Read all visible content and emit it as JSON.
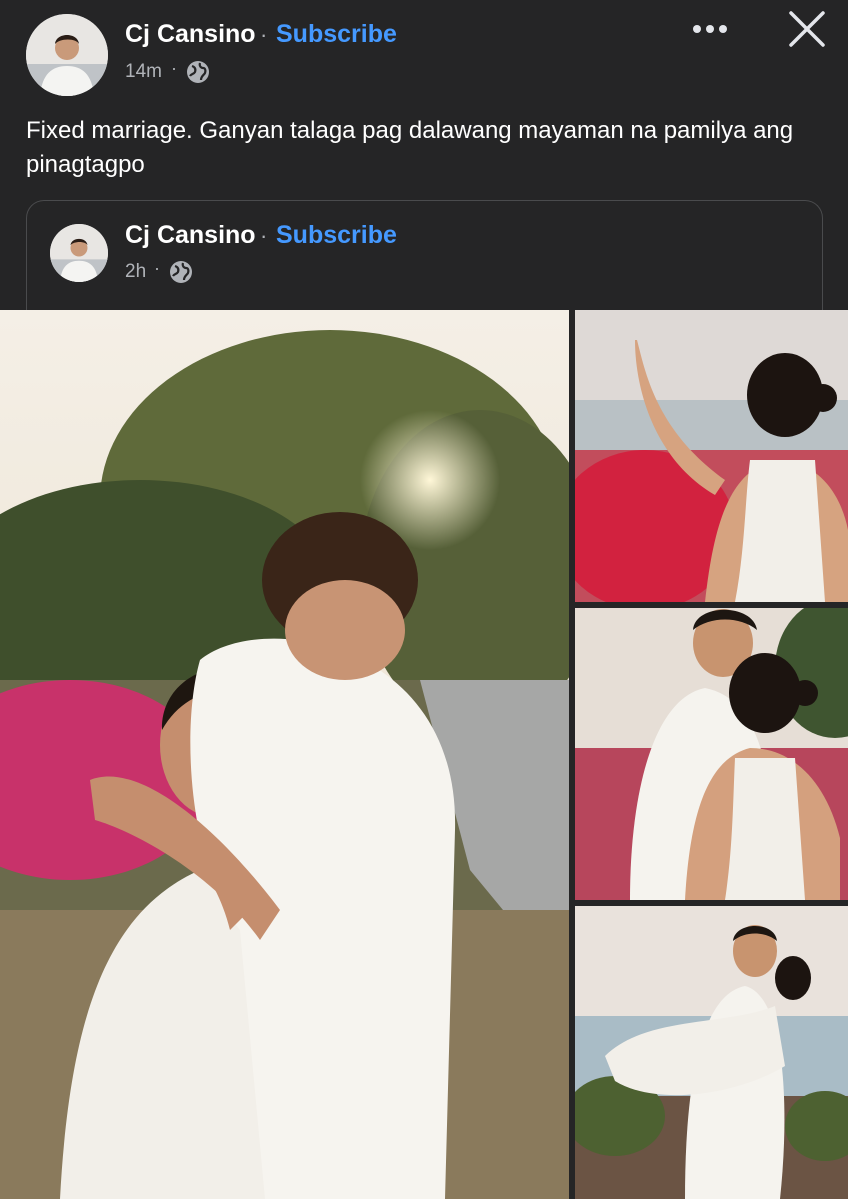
{
  "post": {
    "author": "Cj Cansino",
    "separator": "·",
    "subscribe_label": "Subscribe",
    "time": "14m",
    "time_separator": "·",
    "audience_icon": "globe-icon",
    "text": "Fixed marriage. Ganyan talaga pag dalawang mayaman na pamilya ang pinagtagpo"
  },
  "shared_post": {
    "author": "Cj Cansino",
    "separator": "·",
    "subscribe_label": "Subscribe",
    "time": "2h",
    "time_separator": "·",
    "audience_icon": "globe-icon"
  },
  "toolbar": {
    "more_icon": "more-horizontal-icon",
    "close_icon": "close-icon"
  },
  "photos": [
    "couple-hug-photo",
    "woman-waving-photo",
    "couple-standing-photo",
    "man-carrying-woman-photo"
  ],
  "colors": {
    "background": "#252526",
    "subscribe": "#4599ff",
    "secondary_text": "#b0b3b8"
  }
}
